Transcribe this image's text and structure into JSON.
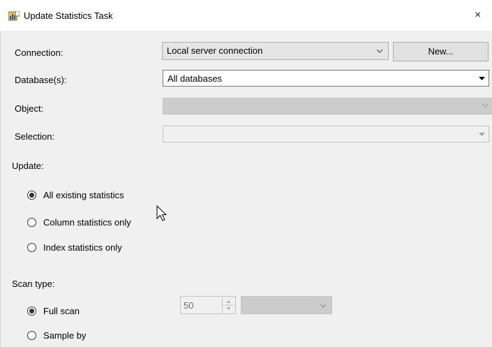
{
  "window": {
    "title": "Update Statistics Task",
    "close_glyph": "×",
    "app_icon": "statistics-task-icon"
  },
  "connection": {
    "label": "Connection:",
    "value": "Local server connection",
    "new_button": "New..."
  },
  "databases": {
    "label": "Database(s):",
    "value": "All databases"
  },
  "object": {
    "label": "Object:",
    "value": ""
  },
  "selection": {
    "label": "Selection:",
    "value": ""
  },
  "update": {
    "label": "Update:",
    "options": [
      {
        "label": "All existing statistics",
        "selected": true
      },
      {
        "label": "Column statistics only",
        "selected": false
      },
      {
        "label": "Index statistics only",
        "selected": false
      }
    ]
  },
  "scan_type": {
    "label": "Scan type:",
    "options": [
      {
        "label": "Full scan",
        "selected": true
      },
      {
        "label": "Sample by",
        "selected": false
      }
    ],
    "sample_value": "50",
    "sample_unit": ""
  },
  "colors": {
    "panel": "#f0f0f0",
    "disabled_field": "#cccccc",
    "border": "#7a7a7a"
  }
}
